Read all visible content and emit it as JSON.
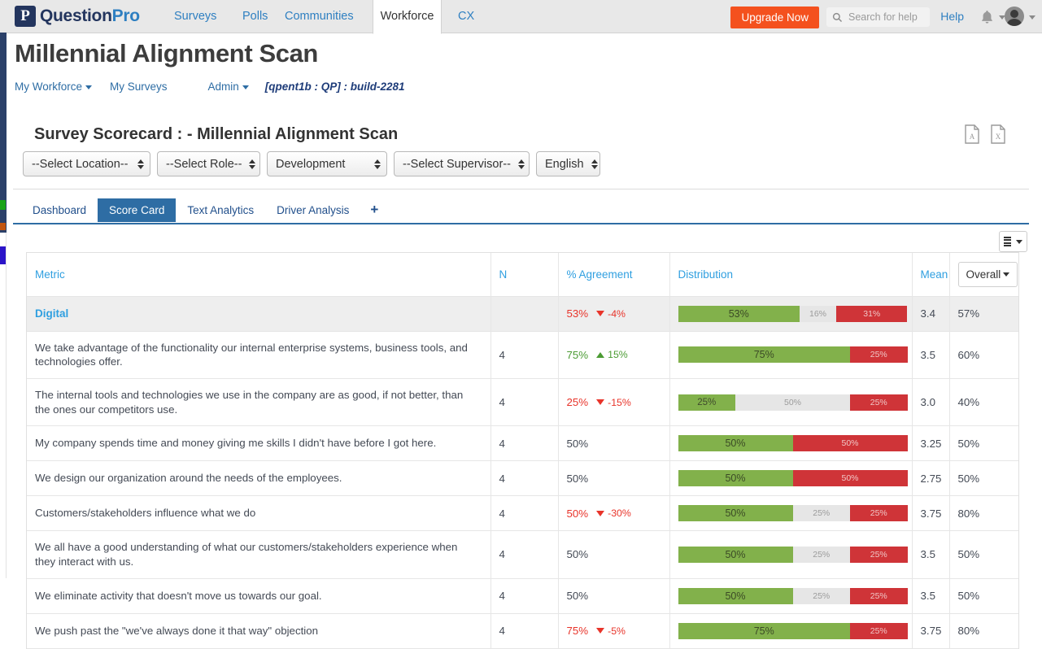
{
  "topnav": {
    "logo": {
      "part_a": "Question",
      "part_b": "Pro",
      "mark": "P"
    },
    "links": [
      {
        "label": "Surveys",
        "active": false
      },
      {
        "label": "Polls",
        "active": false
      },
      {
        "label": "Communities",
        "active": false
      },
      {
        "label": "Workforce",
        "active": true
      },
      {
        "label": "CX",
        "active": false
      }
    ],
    "upgrade_label": "Upgrade Now",
    "search_placeholder": "Search for help",
    "search_value": "",
    "help_label": "Help",
    "icons": {
      "search": "search-icon",
      "bell": "bell-icon",
      "avatar": "avatar-icon"
    }
  },
  "header": {
    "title": "Millennial Alignment Scan",
    "breadcrumbs": [
      {
        "label": "My Workforce",
        "caret": true
      },
      {
        "label": "My Surveys",
        "caret": false
      },
      {
        "label": "Admin",
        "caret": true
      }
    ],
    "build_tag": "[qpent1b : QP] :  build-2281"
  },
  "scorecard": {
    "title": "Survey Scorecard :  -  Millennial Alignment Scan",
    "export": [
      {
        "name": "export-pdf",
        "label": "PDF"
      },
      {
        "name": "export-excel",
        "label": "X"
      }
    ],
    "filters": [
      {
        "name": "location",
        "value": "--Select Location--",
        "width": 157
      },
      {
        "name": "role",
        "value": "--Select Role--",
        "width": 127
      },
      {
        "name": "department",
        "value": "Development",
        "width": 148
      },
      {
        "name": "supervisor",
        "value": "--Select Supervisor--",
        "width": 167
      },
      {
        "name": "language",
        "value": "English",
        "width": 79
      }
    ],
    "tabs": [
      {
        "label": "Dashboard",
        "active": false
      },
      {
        "label": "Score Card",
        "active": true
      },
      {
        "label": "Text Analytics",
        "active": false
      },
      {
        "label": "Driver Analysis",
        "active": false
      }
    ],
    "tab_add_label": "+",
    "column_chooser_label": "",
    "overall_button_label": "Overall"
  },
  "table": {
    "headers": {
      "metric": "Metric",
      "n": "N",
      "agreement": "% Agreement",
      "distribution": "Distribution",
      "mean": "Mean",
      "overall": "Overall"
    },
    "rows": [
      {
        "type": "group",
        "metric": "Digital",
        "n": "",
        "agreement": "53%",
        "agreement_tone": "neg",
        "delta": "-4%",
        "delta_dir": "down",
        "dist": [
          {
            "tone": "g",
            "label": "53%",
            "pct": 53
          },
          {
            "tone": "n",
            "label": "16%",
            "pct": 16
          },
          {
            "tone": "r",
            "label": "31%",
            "pct": 31
          }
        ],
        "mean": "3.4",
        "overall": "57%"
      },
      {
        "type": "item",
        "metric": "We take advantage of the functionality our internal enterprise systems, business tools, and technologies offer.",
        "n": "4",
        "agreement": "75%",
        "agreement_tone": "pos",
        "delta": "15%",
        "delta_dir": "up",
        "dist": [
          {
            "tone": "g",
            "label": "75%",
            "pct": 75
          },
          {
            "tone": "r",
            "label": "25%",
            "pct": 25
          }
        ],
        "mean": "3.5",
        "overall": "60%"
      },
      {
        "type": "item",
        "metric": "The internal tools and technologies we use in the company are as good, if not better, than the ones our competitors use.",
        "n": "4",
        "agreement": "25%",
        "agreement_tone": "neg",
        "delta": "-15%",
        "delta_dir": "down",
        "dist": [
          {
            "tone": "g",
            "label": "25%",
            "pct": 25
          },
          {
            "tone": "n",
            "label": "50%",
            "pct": 50
          },
          {
            "tone": "r",
            "label": "25%",
            "pct": 25
          }
        ],
        "mean": "3.0",
        "overall": "40%"
      },
      {
        "type": "item",
        "metric": "My company spends time and money giving me skills I didn't have before I got here.",
        "n": "4",
        "agreement": "50%",
        "agreement_tone": "flat",
        "delta": "",
        "delta_dir": "",
        "dist": [
          {
            "tone": "g",
            "label": "50%",
            "pct": 50
          },
          {
            "tone": "r",
            "label": "50%",
            "pct": 50
          }
        ],
        "mean": "3.25",
        "overall": "50%"
      },
      {
        "type": "item",
        "metric": "We design our organization around the needs of the employees.",
        "n": "4",
        "agreement": "50%",
        "agreement_tone": "flat",
        "delta": "",
        "delta_dir": "",
        "dist": [
          {
            "tone": "g",
            "label": "50%",
            "pct": 50
          },
          {
            "tone": "r",
            "label": "50%",
            "pct": 50
          }
        ],
        "mean": "2.75",
        "overall": "50%"
      },
      {
        "type": "item",
        "metric": "Customers/stakeholders influence what we do",
        "n": "4",
        "agreement": "50%",
        "agreement_tone": "neg",
        "delta": "-30%",
        "delta_dir": "down",
        "dist": [
          {
            "tone": "g",
            "label": "50%",
            "pct": 50
          },
          {
            "tone": "n",
            "label": "25%",
            "pct": 25
          },
          {
            "tone": "r",
            "label": "25%",
            "pct": 25
          }
        ],
        "mean": "3.75",
        "overall": "80%"
      },
      {
        "type": "item",
        "metric": "We all have a good understanding of what our customers/stakeholders experience when they interact with us.",
        "n": "4",
        "agreement": "50%",
        "agreement_tone": "flat",
        "delta": "",
        "delta_dir": "",
        "dist": [
          {
            "tone": "g",
            "label": "50%",
            "pct": 50
          },
          {
            "tone": "n",
            "label": "25%",
            "pct": 25
          },
          {
            "tone": "r",
            "label": "25%",
            "pct": 25
          }
        ],
        "mean": "3.5",
        "overall": "50%"
      },
      {
        "type": "item",
        "metric": "We eliminate activity that doesn't move us towards our goal.",
        "n": "4",
        "agreement": "50%",
        "agreement_tone": "flat",
        "delta": "",
        "delta_dir": "",
        "dist": [
          {
            "tone": "g",
            "label": "50%",
            "pct": 50
          },
          {
            "tone": "n",
            "label": "25%",
            "pct": 25
          },
          {
            "tone": "r",
            "label": "25%",
            "pct": 25
          }
        ],
        "mean": "3.5",
        "overall": "50%"
      },
      {
        "type": "item",
        "metric": "We push past the \"we've always done it that way\" objection",
        "n": "4",
        "agreement": "75%",
        "agreement_tone": "neg",
        "delta": "-5%",
        "delta_dir": "down",
        "dist": [
          {
            "tone": "g",
            "label": "75%",
            "pct": 75
          },
          {
            "tone": "r",
            "label": "25%",
            "pct": 25
          }
        ],
        "mean": "3.75",
        "overall": "80%"
      }
    ]
  },
  "colors": {
    "brand_navy": "#23355e",
    "brand_blue": "#2e7fc1",
    "accent_orange": "#f4511e",
    "header_blue": "#2f9fe0",
    "tab_active": "#2e6da4",
    "positive_green": "#4b9b33",
    "negative_red": "#e8342a",
    "bar_green": "#82b14b",
    "bar_red": "#cf3438",
    "bar_neutral": "#e6e6e6"
  }
}
